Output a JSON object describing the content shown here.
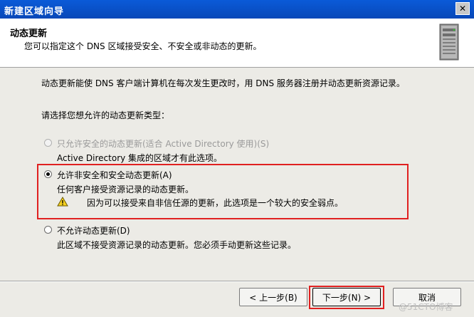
{
  "window": {
    "title": "新建区域向导",
    "close_glyph": "✕"
  },
  "header": {
    "title": "动态更新",
    "subtitle": "您可以指定这个 DNS 区域接受安全、不安全或非动态的更新。",
    "icon": "server-icon"
  },
  "body": {
    "intro": "动态更新能使 DNS 客户端计算机在每次发生更改时，用 DNS 服务器注册并动态更新资源记录。",
    "prompt": "请选择您想允许的动态更新类型：",
    "options": [
      {
        "label": "只允许安全的动态更新(适合 Active Directory 使用)(S)",
        "description": "Active Directory 集成的区域才有此选项。",
        "selected": false,
        "enabled": false
      },
      {
        "label": "允许非安全和安全动态更新(A)",
        "description": "任何客户接受资源记录的动态更新。",
        "warning": "因为可以接受来自非信任源的更新，此选项是一个较大的安全弱点。",
        "selected": true,
        "enabled": true
      },
      {
        "label": "不允许动态更新(D)",
        "description": "此区域不接受资源记录的动态更新。您必须手动更新这些记录。",
        "selected": false,
        "enabled": true
      }
    ]
  },
  "buttons": {
    "back": "< 上一步(B)",
    "next": "下一步(N) >",
    "cancel": "取消"
  },
  "watermark": "@51CTO博客",
  "colors": {
    "highlight_box": "#e02020",
    "titlebar": "#0a5ad8"
  }
}
